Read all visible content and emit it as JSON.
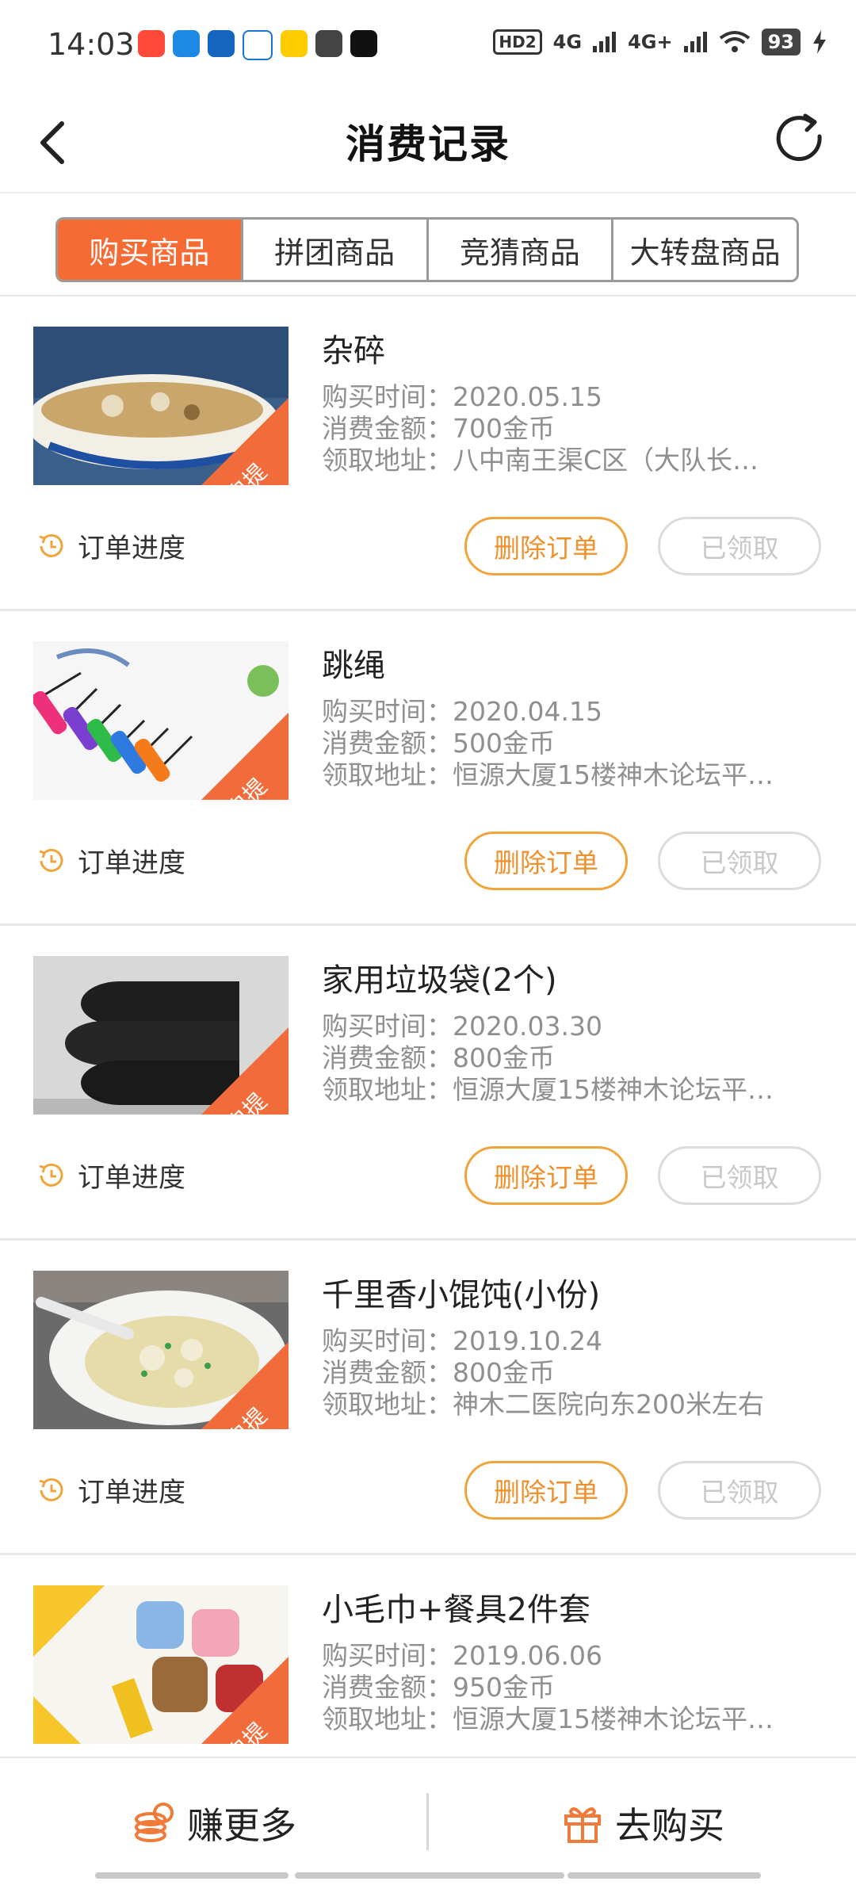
{
  "status_bar": {
    "time": "14:03",
    "hd": "HD2",
    "signal1": "4G",
    "signal2": "4G+",
    "battery": "93"
  },
  "header": {
    "title": "消费记录",
    "back_icon": "chevron-left-icon",
    "refresh_icon": "refresh-icon"
  },
  "tabs": [
    {
      "label": "购买商品",
      "active": true
    },
    {
      "label": "拼团商品",
      "active": false
    },
    {
      "label": "竞猜商品",
      "active": false
    },
    {
      "label": "大转盘商品",
      "active": false
    }
  ],
  "labels": {
    "time_prefix": "购买时间：",
    "amount_prefix": "消费金额：",
    "address_prefix": "领取地址：",
    "progress": "订单进度",
    "delete": "删除订单",
    "received": "已领取",
    "pickup_badge": "自提"
  },
  "orders": [
    {
      "name": "杂碎",
      "time": "2020.05.15",
      "amount": "700金币",
      "address": "八中南王渠C区（大队长…"
    },
    {
      "name": "跳绳",
      "time": "2020.04.15",
      "amount": "500金币",
      "address": "恒源大厦15楼神木论坛平…"
    },
    {
      "name": "家用垃圾袋(2个)",
      "time": "2020.03.30",
      "amount": "800金币",
      "address": "恒源大厦15楼神木论坛平…"
    },
    {
      "name": "千里香小馄饨(小份)",
      "time": "2019.10.24",
      "amount": "800金币",
      "address": "神木二医院向东200米左右"
    },
    {
      "name": "小毛巾+餐具2件套",
      "time": "2019.06.06",
      "amount": "950金币",
      "address": "恒源大厦15楼神木论坛平…"
    }
  ],
  "bottom_bar": {
    "earn": "赚更多",
    "buy": "去购买",
    "earn_icon": "coins-icon",
    "buy_icon": "gift-icon"
  },
  "colors": {
    "accent": "#f66a34",
    "delete_border": "#f0a43c",
    "muted": "#8f8f8f"
  }
}
